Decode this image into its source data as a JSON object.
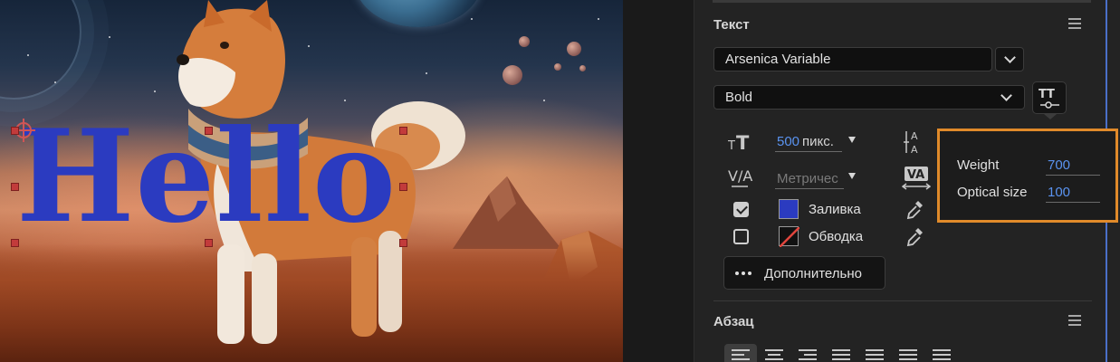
{
  "canvas": {
    "text_layer": "Hello",
    "text_color": "#2b3bc0",
    "handle_color": "#c23b3b"
  },
  "text_section": {
    "title": "Текст",
    "font_family": "Arsenica Variable",
    "font_style": "Bold",
    "font_size_value": "500",
    "font_size_unit": "пикс.",
    "kerning_value": "Метричес",
    "fill_label": "Заливка",
    "fill_checked": true,
    "fill_color": "#2b3bc0",
    "stroke_label": "Обводка",
    "stroke_checked": false,
    "more_label": "Дополнительно"
  },
  "variable_axes": {
    "items": [
      {
        "label": "Weight",
        "value": "700"
      },
      {
        "label": "Optical size",
        "value": "100"
      }
    ],
    "highlight_color": "#e08a2a"
  },
  "paragraph_section": {
    "title": "Абзац",
    "selected_alignment": "left"
  },
  "icons": {
    "font_size": "font-size-icon",
    "leading": "leading-icon",
    "kerning": "kerning-icon",
    "tracking": "tracking-icon",
    "eyedropper": "eyedropper-icon",
    "variable_font": "variable-font-icon",
    "panel_menu": "hamburger-menu-icon"
  },
  "colors": {
    "accent": "#5a93f0",
    "panel_bg": "#232323"
  }
}
